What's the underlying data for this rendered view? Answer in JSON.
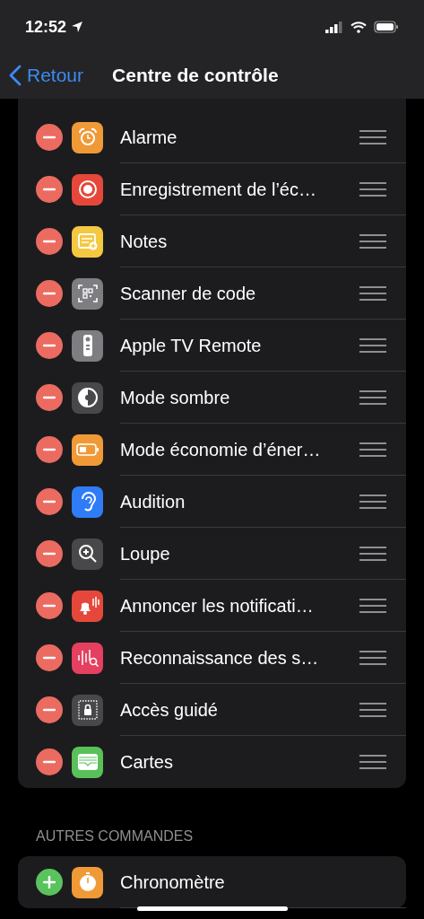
{
  "status_bar": {
    "time": "12:52"
  },
  "nav": {
    "back": "Retour",
    "title": "Centre de contrôle"
  },
  "sections": [
    {
      "items": [
        {
          "label": "Alarme",
          "kind": "remove",
          "color": "#f09a37"
        },
        {
          "label": "Enregistrement de l’éc…",
          "kind": "remove",
          "color": "#e5483a"
        },
        {
          "label": "Notes",
          "kind": "remove",
          "color": "#f5c842"
        },
        {
          "label": "Scanner de code",
          "kind": "remove",
          "color": "#7d7d82"
        },
        {
          "label": "Apple TV Remote",
          "kind": "remove",
          "color": "#7d7d82"
        },
        {
          "label": "Mode sombre",
          "kind": "remove",
          "color": "#48484a"
        },
        {
          "label": "Mode économie d’éner…",
          "kind": "remove",
          "color": "#f09a37"
        },
        {
          "label": "Audition",
          "kind": "remove",
          "color": "#2f7cf6"
        },
        {
          "label": "Loupe",
          "kind": "remove",
          "color": "#48484a"
        },
        {
          "label": "Annoncer les notificati…",
          "kind": "remove",
          "color": "#e5483a"
        },
        {
          "label": "Reconnaissance des s…",
          "kind": "remove",
          "color": "#e5405f"
        },
        {
          "label": "Accès guidé",
          "kind": "remove",
          "color": "#48484a"
        },
        {
          "label": "Cartes",
          "kind": "remove",
          "color": "#5ac05a"
        }
      ]
    },
    {
      "header": "AUTRES COMMANDES",
      "items": [
        {
          "label": "Chronomètre",
          "kind": "add",
          "color": "#f09a37"
        }
      ]
    }
  ]
}
